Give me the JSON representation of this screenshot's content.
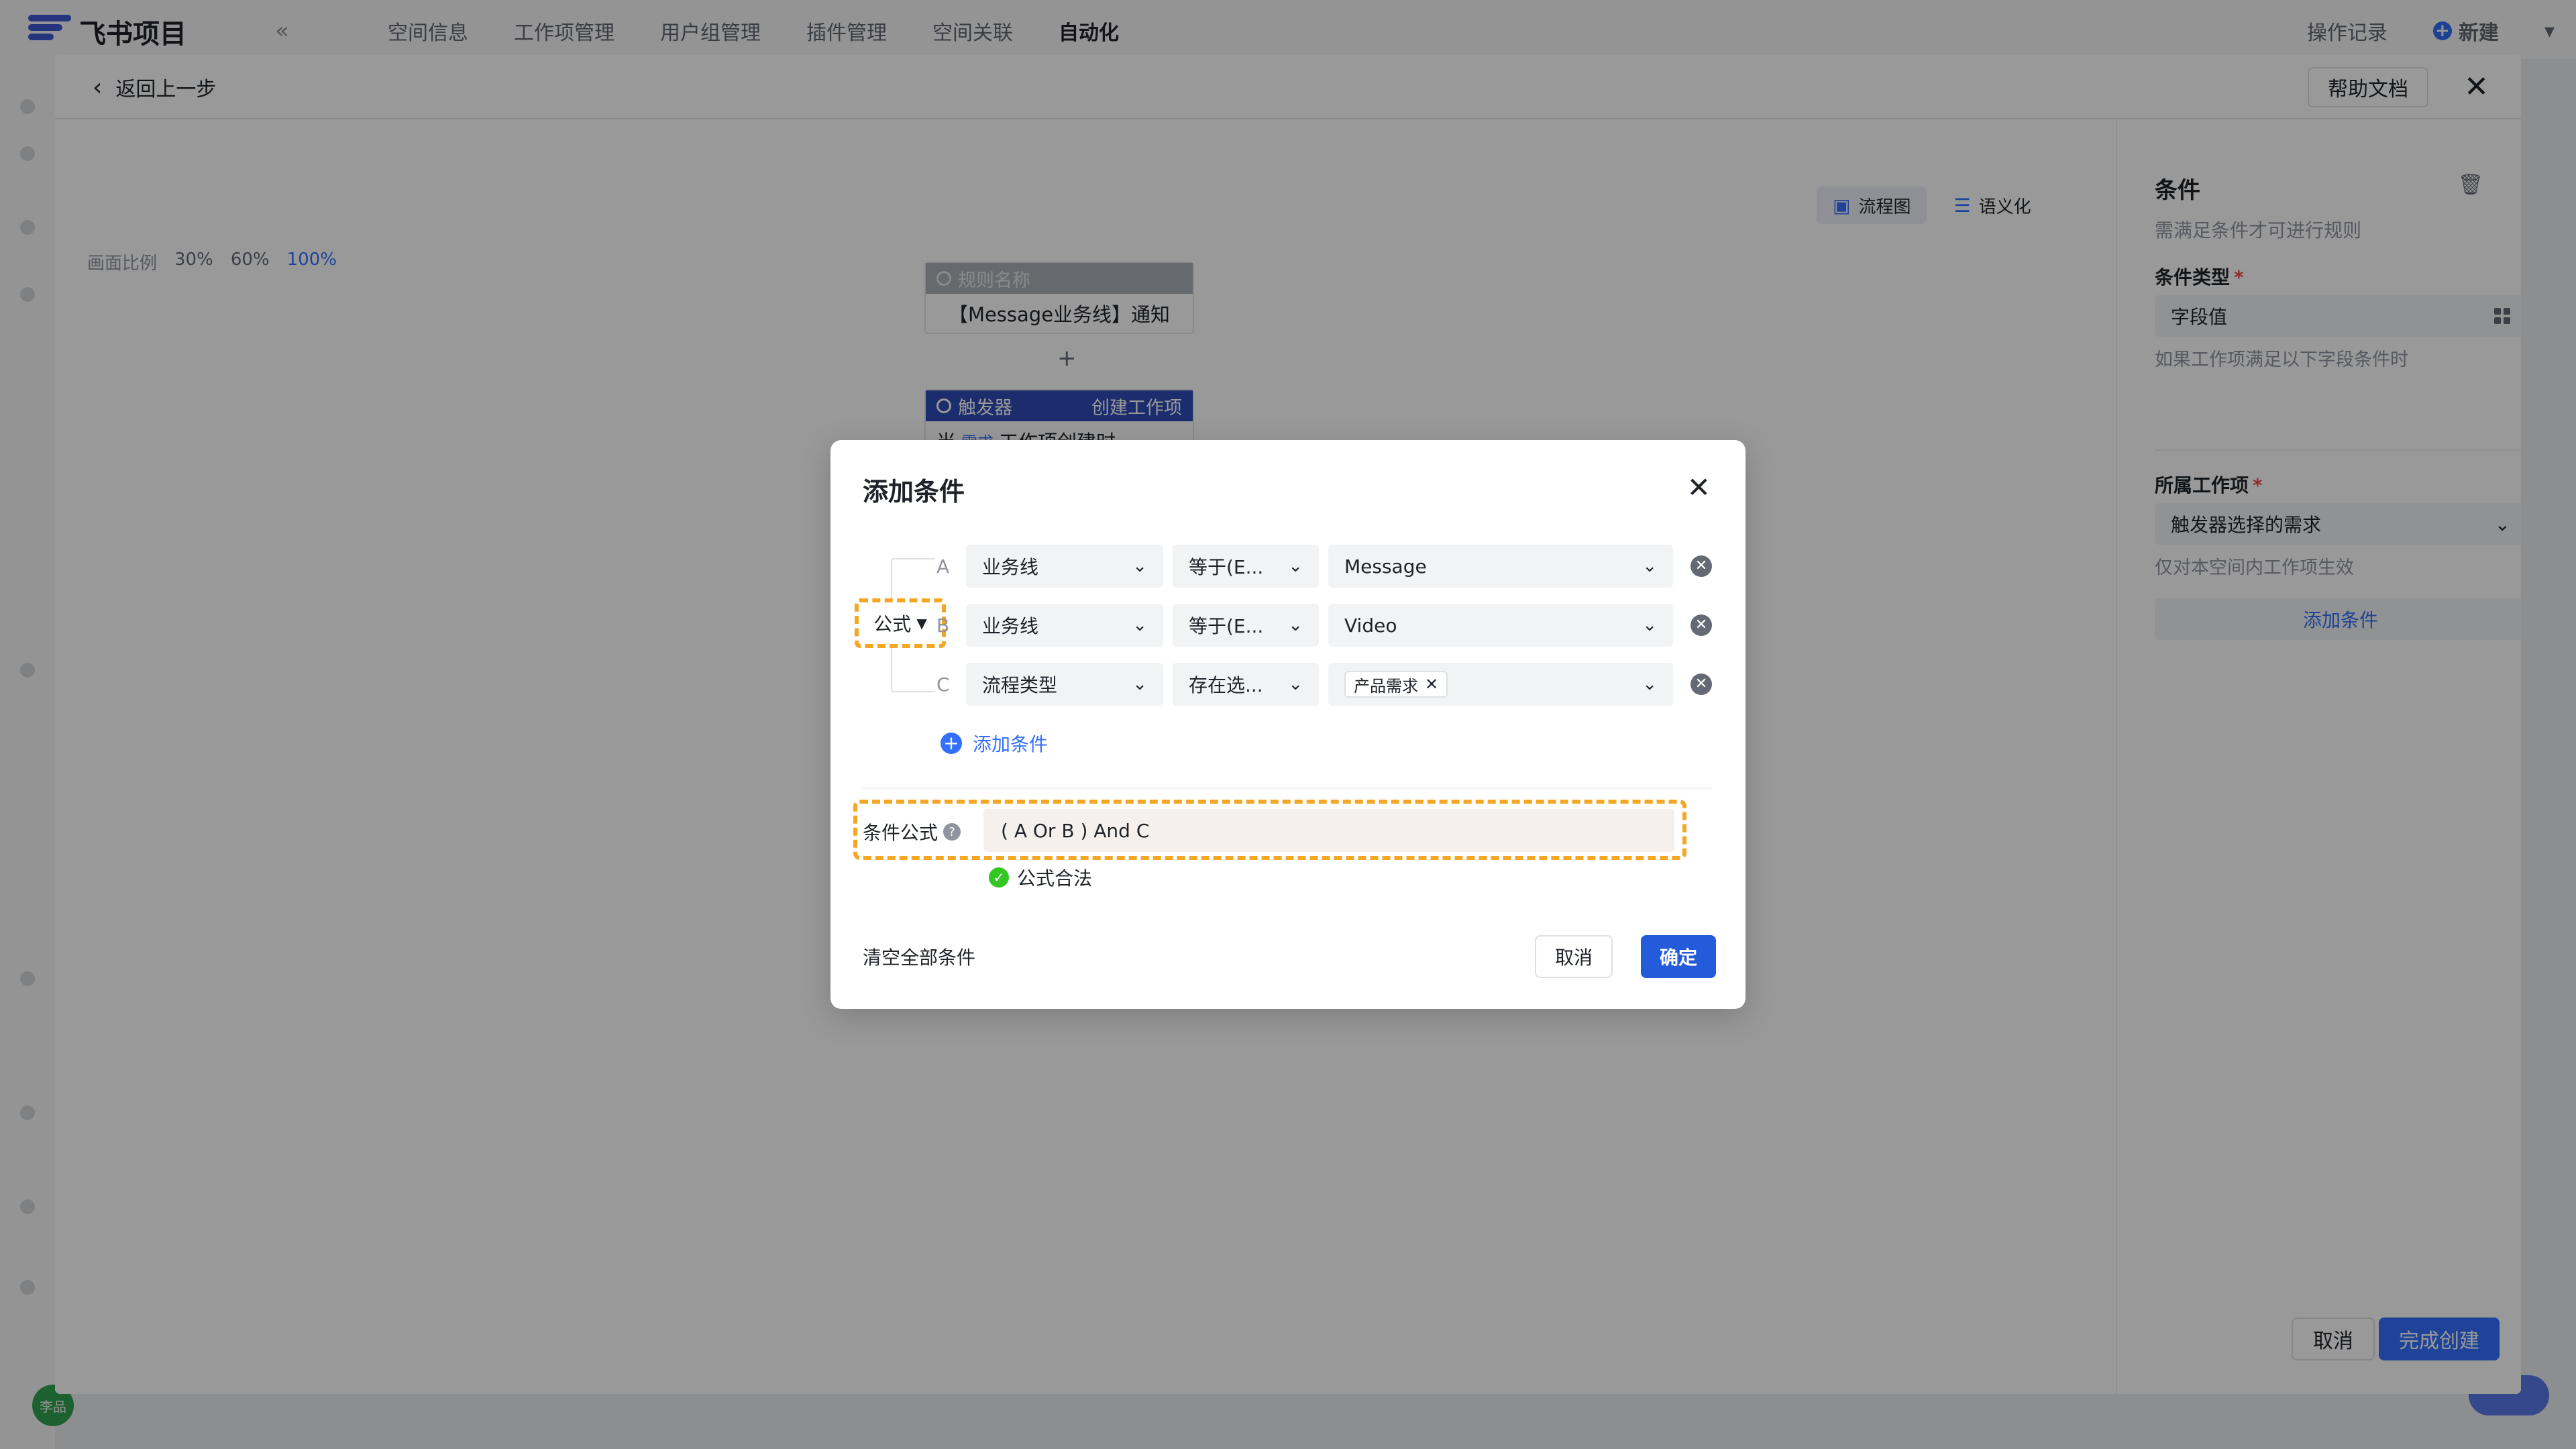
{
  "app": {
    "title": "飞书项目",
    "nav": [
      "空间信息",
      "工作项管理",
      "用户组管理",
      "插件管理",
      "空间关联",
      "自动化"
    ],
    "active_nav": "自动化",
    "operation_log": "操作记录",
    "new_label": "新建",
    "avatar_text": "李品"
  },
  "editor": {
    "back_label": "返回上一步",
    "help_label": "帮助文档",
    "view_flow": "流程图",
    "view_semantic": "语义化",
    "zoom_label": "画面比例",
    "zoom_options": [
      "30%",
      "60%",
      "100%"
    ],
    "rule_card": {
      "header": "规则名称",
      "body": "【Message业务线】通知"
    },
    "trigger_card": {
      "header": "触发器",
      "header_right": "创建工作项",
      "prefix": "当",
      "tag": "需求",
      "suffix": "工作项创建时"
    },
    "plus": "+",
    "footer_cancel": "取消",
    "footer_done": "完成创建"
  },
  "right_panel": {
    "title": "条件",
    "desc": "需满足条件才可进行规则",
    "type_label": "条件类型",
    "type_value": "字段值",
    "type_hint": "如果工作项满足以下字段条件时",
    "item_label": "所属工作项",
    "item_value": "触发器选择的需求",
    "item_hint": "仅对本空间内工作项生效",
    "add_label": "添加条件",
    "required_mark": "*"
  },
  "dialog": {
    "title": "添加条件",
    "logic_label": "公式",
    "rows": [
      {
        "letter": "A",
        "field": "业务线",
        "op": "等于(E...",
        "value": "Message"
      },
      {
        "letter": "B",
        "field": "业务线",
        "op": "等于(E...",
        "value": "Video"
      },
      {
        "letter": "C",
        "field": "流程类型",
        "op": "存在选...",
        "chip": "产品需求"
      }
    ],
    "add_condition": "添加条件",
    "formula_label": "条件公式",
    "formula_value": "( A Or B ) And C",
    "formula_valid": "公式合法",
    "clear_all": "清空全部条件",
    "cancel": "取消",
    "ok": "确定"
  },
  "colors": {
    "primary": "#3370ff",
    "confirm": "#245bdb",
    "highlight_dash": "#f5a623",
    "valid": "#34c724"
  }
}
